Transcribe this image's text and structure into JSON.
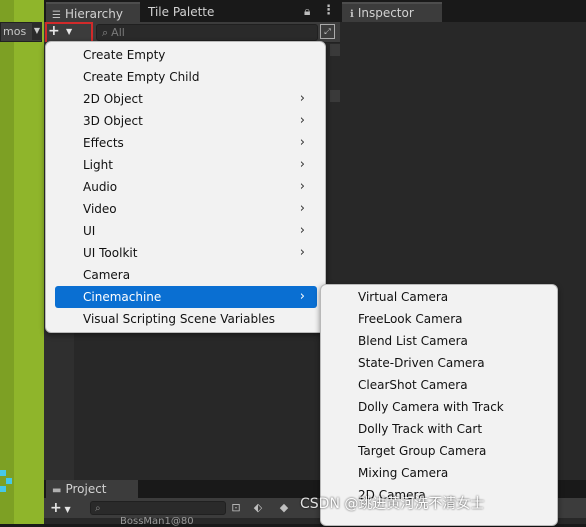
{
  "scene": {
    "gizmos_tab": "mos"
  },
  "hierarchy": {
    "tab_label": "Hierarchy",
    "tab_tile_palette": "Tile Palette",
    "add_button": "+",
    "search_placeholder": "All",
    "lock_icon": "lock-icon",
    "menu_icon": "kebab-icon"
  },
  "inspector": {
    "tab_label": "Inspector"
  },
  "project": {
    "tab_label": "Project",
    "add_button": "+",
    "row_text": "BossMan1@80"
  },
  "create_menu": {
    "items": [
      {
        "label": "Create Empty",
        "submenu": false
      },
      {
        "label": "Create Empty Child",
        "submenu": false
      },
      {
        "label": "2D Object",
        "submenu": true
      },
      {
        "label": "3D Object",
        "submenu": true
      },
      {
        "label": "Effects",
        "submenu": true
      },
      {
        "label": "Light",
        "submenu": true
      },
      {
        "label": "Audio",
        "submenu": true
      },
      {
        "label": "Video",
        "submenu": true
      },
      {
        "label": "UI",
        "submenu": true
      },
      {
        "label": "UI Toolkit",
        "submenu": true
      },
      {
        "label": "Camera",
        "submenu": false
      },
      {
        "label": "Cinemachine",
        "submenu": true,
        "highlighted": true
      },
      {
        "label": "Visual Scripting Scene Variables",
        "submenu": false
      }
    ]
  },
  "cinemachine_menu": {
    "items": [
      "Virtual Camera",
      "FreeLook Camera",
      "Blend List Camera",
      "State-Driven Camera",
      "ClearShot Camera",
      "Dolly Camera with Track",
      "Dolly Track with Cart",
      "Target Group Camera",
      "Mixing Camera",
      "2D Camera"
    ]
  },
  "watermark": "CSDN @跳进黄河洗不清女士",
  "colors": {
    "highlight": "#0a6fd2",
    "annotation_box": "#d12a2a",
    "scene_green": "#8fb52b"
  }
}
